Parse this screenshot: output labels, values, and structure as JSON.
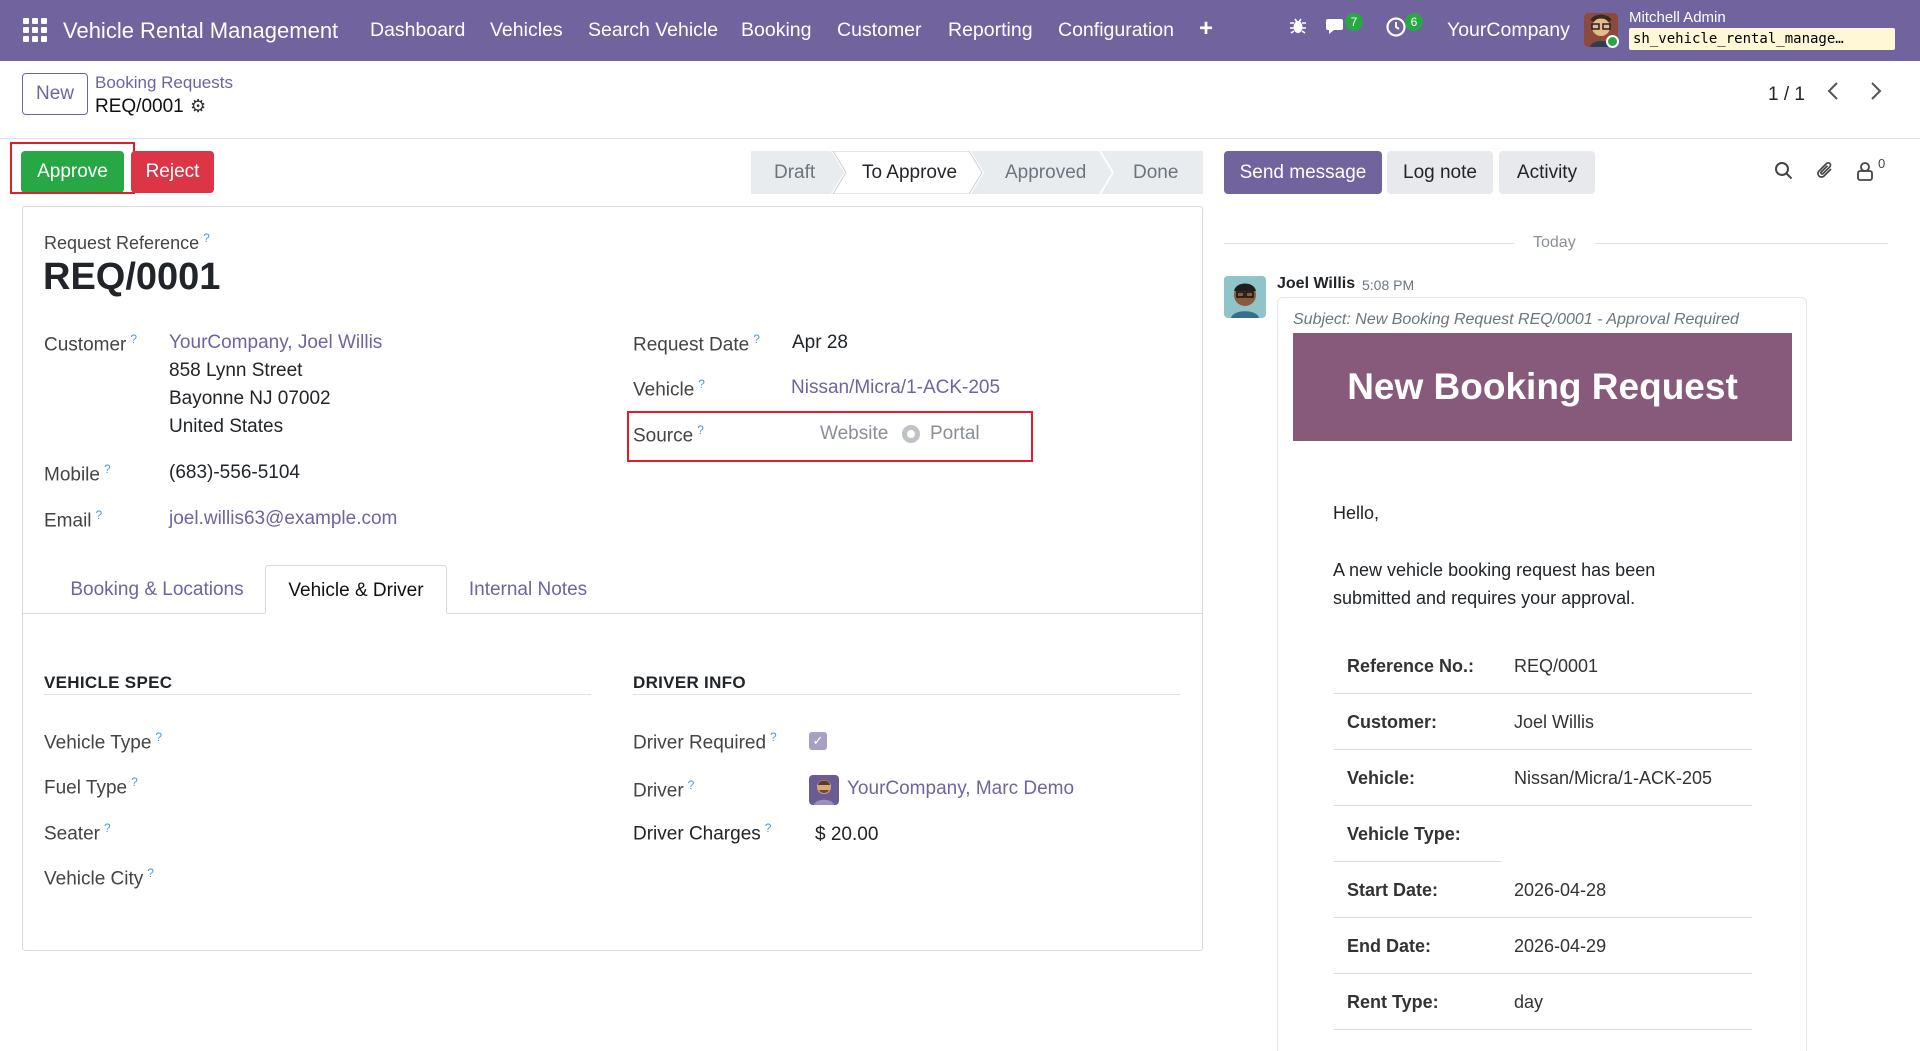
{
  "navbar": {
    "app_title": "Vehicle Rental Management",
    "menus": [
      "Dashboard",
      "Vehicles",
      "Search Vehicle",
      "Booking",
      "Customer",
      "Reporting",
      "Configuration"
    ],
    "plus": "+",
    "chat_count": "7",
    "activity_count": "6",
    "company": "YourCompany",
    "user": "Mitchell Admin",
    "db": "sh_vehicle_rental_manage…"
  },
  "control": {
    "new_label": "New",
    "breadcrumb": "Booking Requests",
    "record": "REQ/0001",
    "pager": "1 / 1"
  },
  "actions": {
    "approve": "Approve",
    "reject": "Reject"
  },
  "stages": [
    "Draft",
    "To Approve",
    "Approved",
    "Done"
  ],
  "active_stage": "To Approve",
  "form": {
    "ref_label": "Request Reference",
    "ref_value": "REQ/0001",
    "customer_label": "Customer",
    "customer_name": "YourCompany, Joel Willis",
    "addr1": "858 Lynn Street",
    "addr2": "Bayonne NJ 07002",
    "addr3": "United States",
    "mobile_label": "Mobile",
    "mobile": "(683)-556-5104",
    "email_label": "Email",
    "email": "joel.willis63@example.com",
    "date_label": "Request Date",
    "date": "Apr 28",
    "vehicle_label": "Vehicle",
    "vehicle": "Nissan/Micra/1-ACK-205",
    "source_label": "Source",
    "source_opt1": "Website",
    "source_opt2": "Portal",
    "tabs": [
      "Booking & Locations",
      "Vehicle & Driver",
      "Internal Notes"
    ],
    "vehicle_spec": "VEHICLE SPEC",
    "driver_info": "DRIVER INFO",
    "vtype": "Vehicle Type",
    "ftype": "Fuel Type",
    "seater": "Seater",
    "vcity": "Vehicle City",
    "driver_req": "Driver Required",
    "driver_label": "Driver",
    "driver": "YourCompany, Marc Demo",
    "charges_label": "Driver Charges",
    "charges": "$ 20.00"
  },
  "chatter": {
    "send": "Send message",
    "log": "Log note",
    "activity": "Activity",
    "followers": "0",
    "today": "Today",
    "author": "Joel Willis",
    "time": "5:08 PM",
    "subject": "Subject: New Booking Request REQ/0001 - Approval Required",
    "banner": "New Booking Request",
    "hello": "Hello,",
    "body1": "A new vehicle booking request has been",
    "body2": "submitted and requires your approval.",
    "rows": [
      {
        "k": "Reference No.:",
        "v": "REQ/0001"
      },
      {
        "k": "Customer:",
        "v": "Joel Willis"
      },
      {
        "k": "Vehicle:",
        "v": "Nissan/Micra/1-ACK-205"
      },
      {
        "k": "Vehicle Type:",
        "v": ""
      },
      {
        "k": "Start Date:",
        "v": "2026-04-28"
      },
      {
        "k": "End Date:",
        "v": "2026-04-29"
      },
      {
        "k": "Rent Type:",
        "v": "day"
      }
    ]
  },
  "colors": {
    "brand": "#71639e",
    "approve": "#28a745",
    "reject": "#dc3545",
    "highlight": "#e11d2a",
    "banner": "#875a7b"
  }
}
